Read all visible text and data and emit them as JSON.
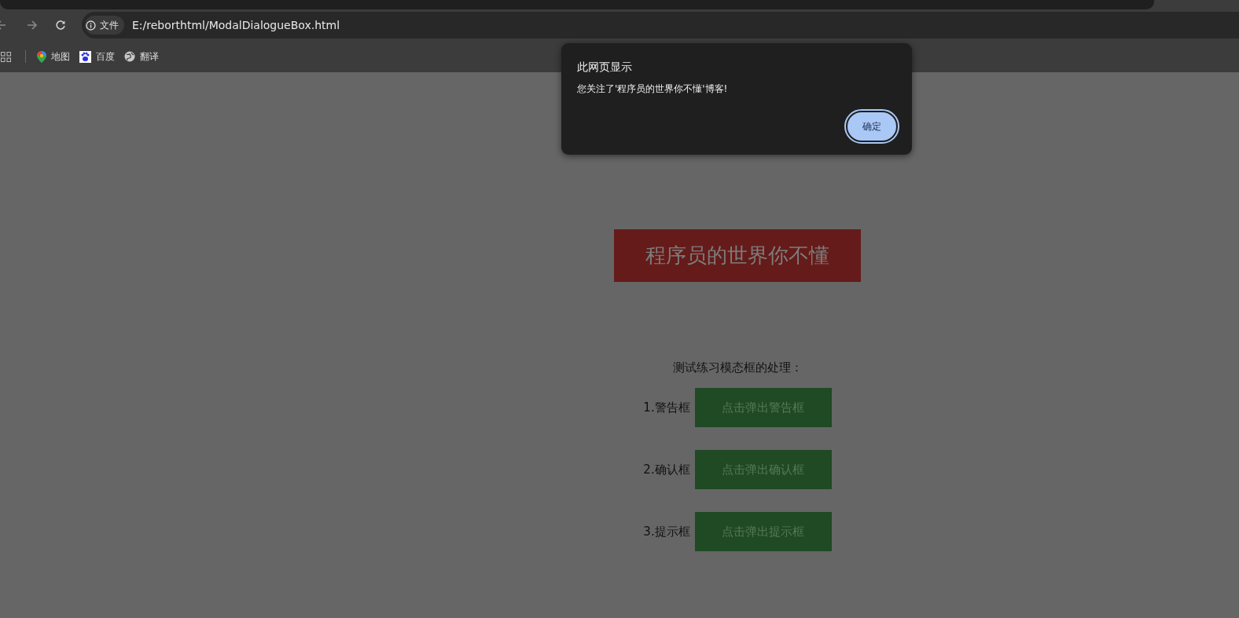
{
  "browser": {
    "site_info": "文件",
    "url": "E:/reborthtml/ModalDialogueBox.html",
    "bookmarks": [
      {
        "label": "地图",
        "kind": "maps"
      },
      {
        "label": "百度",
        "kind": "baidu"
      },
      {
        "label": "翻译",
        "kind": "globe"
      }
    ]
  },
  "page": {
    "banner": "程序员的世界你不懂",
    "intro": "测试练习模态框的处理：",
    "rows": [
      {
        "label": "1.警告框",
        "button": "点击弹出警告框"
      },
      {
        "label": "2.确认框",
        "button": "点击弹出确认框"
      },
      {
        "label": "3.提示框",
        "button": "点击弹出提示框"
      }
    ]
  },
  "dialog": {
    "title": "此网页显示",
    "message": "您关注了'程序员的世界你不懂'博客!",
    "ok_button": "确定"
  }
}
